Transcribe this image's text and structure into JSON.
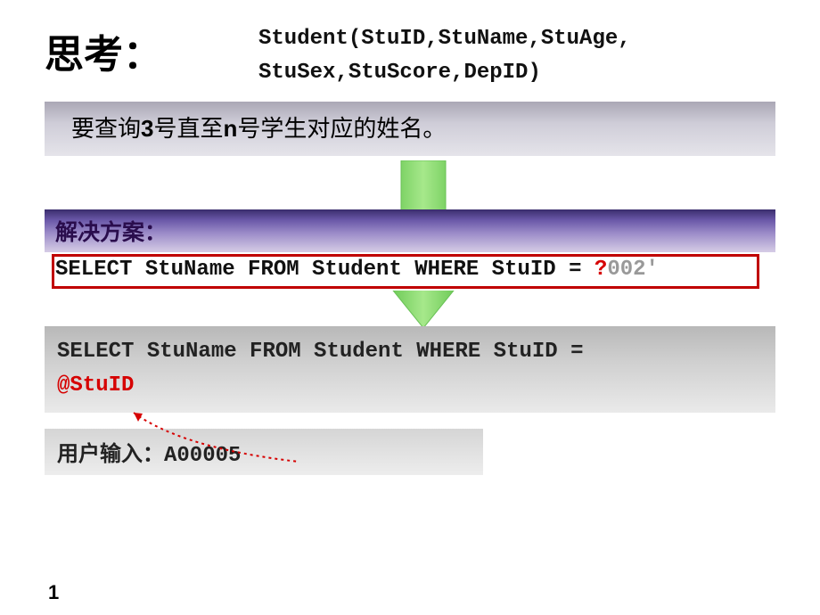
{
  "title": "思考：",
  "schema_line1": "Student(StuID,StuName,StuAge,",
  "schema_line2": "StuSex,StuScore,DepID)",
  "question_plain": "要查询",
  "question_three": "3",
  "question_mid": "号直至",
  "question_n": "n",
  "question_tail": "号学生对应的姓名。",
  "solution_label": "解决方案：",
  "sql1_pre": "SELECT StuName FROM Student WHERE StuID = ",
  "sql1_qmark": "?",
  "sql1_tail": "002'",
  "sql2_line1": "SELECT StuName FROM Student WHERE StuID =",
  "sql2_highlight": "@StuID",
  "user_input_label": "用户输入：",
  "user_input_value": "A00005",
  "page_number": "1"
}
